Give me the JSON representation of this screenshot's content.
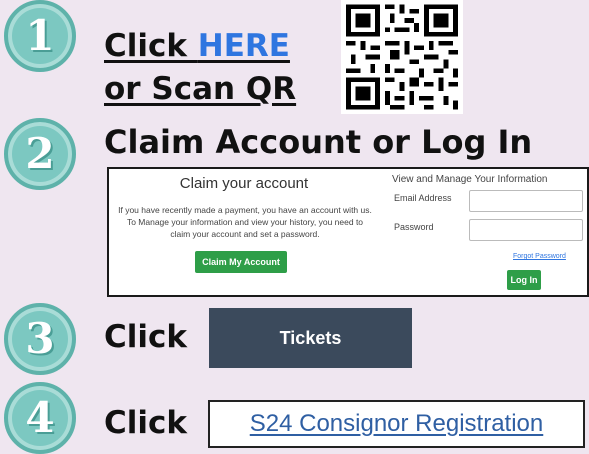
{
  "colors": {
    "background": "#efe6f0",
    "step_circle": "#7cc8c1",
    "link_blue": "#2f76e0",
    "green_button": "#2e9e48",
    "tickets_bg": "#3b4a5c"
  },
  "steps": [
    {
      "number": "1",
      "line1_prefix": "Click ",
      "line1_link": "HERE",
      "line2": "or Scan QR"
    },
    {
      "number": "2",
      "heading": "Claim Account or Log In"
    },
    {
      "number": "3",
      "prefix": "Click"
    },
    {
      "number": "4",
      "prefix": "Click"
    }
  ],
  "qr": {
    "icon": "qr-code-icon"
  },
  "claim_panel": {
    "title": "Claim your account",
    "description": "If you have recently made a payment, you have an account with us. To Manage your information and view your history, you need to claim your account and set a password.",
    "claim_button": "Claim My Account",
    "manage_title": "View and Manage Your Information",
    "email_label": "Email Address",
    "email_value": "",
    "password_label": "Password",
    "password_value": "",
    "forgot_link": "Forgot Password",
    "login_button": "Log In"
  },
  "tickets_button": "Tickets",
  "registration_link": "S24 Consignor Registration"
}
